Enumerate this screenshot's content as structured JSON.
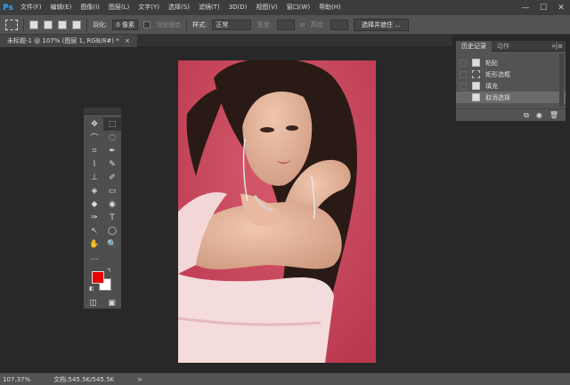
{
  "app": {
    "logo": "Ps"
  },
  "menu": [
    "文件(F)",
    "编辑(E)",
    "图像(I)",
    "图层(L)",
    "文字(Y)",
    "选择(S)",
    "滤镜(T)",
    "3D(D)",
    "视图(V)",
    "窗口(W)",
    "帮助(H)"
  ],
  "window_controls": {
    "minimize": "—",
    "maximize": "☐",
    "close": "✕"
  },
  "options": {
    "feather_label": "羽化:",
    "feather_value": "0 像素",
    "antialias_label": "消除锯齿",
    "style_label": "样式:",
    "style_value": "正常",
    "width_label": "宽度:",
    "height_label": "高度:",
    "swap": "⇄",
    "select_mask_button": "选择并遮住 ..."
  },
  "document": {
    "tab": "未标题-1 @ 107% (图层 1, RGB/8#) *",
    "close": "×"
  },
  "toolbar": {
    "collapse": "«",
    "tools": [
      "✥",
      "⬚",
      "⌒",
      "◌",
      "⌗",
      "✒",
      "⌇",
      "✎",
      "⊥",
      "✐",
      "◈",
      "▭",
      "◆",
      "◉",
      "✑",
      "T",
      "↖",
      "◯",
      "✋",
      "🔍",
      "…",
      ""
    ]
  },
  "colors": {
    "foreground": "#e60000",
    "background": "#ffffff"
  },
  "history": {
    "tabs": [
      "历史记录",
      "动作"
    ],
    "more": "»|≡",
    "items": [
      {
        "label": "粘贴",
        "selected": false
      },
      {
        "label": "矩形选框",
        "selected": false
      },
      {
        "label": "填充",
        "selected": false
      },
      {
        "label": "取消选择",
        "selected": true
      }
    ]
  },
  "status": {
    "zoom": "107.37%",
    "doc_info": "文档:545.5K/545.5K",
    "arrow": ">"
  }
}
